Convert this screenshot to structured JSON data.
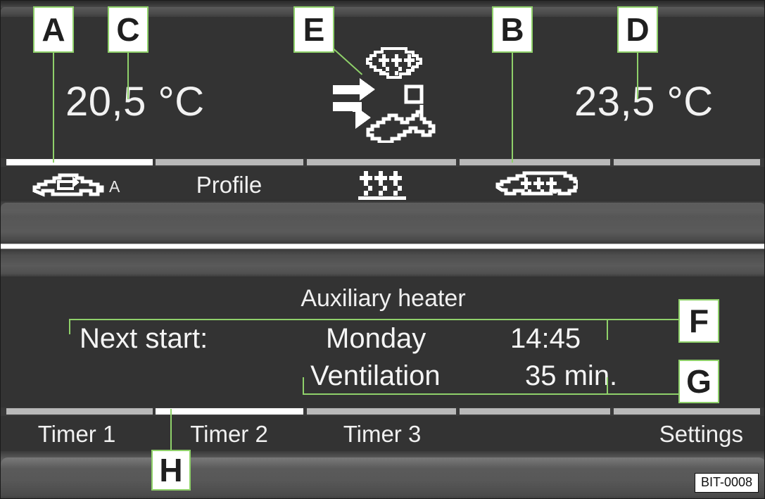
{
  "device": {
    "code_label": "BIT-0008"
  },
  "climate": {
    "temp_left": "20,5 °C",
    "temp_right": "23,5 °C",
    "airflow_icon": "airflow-windshield-and-body-icon"
  },
  "top_tabs": [
    {
      "label": "",
      "icon": "air-recirculation-car-icon",
      "sub": "A",
      "active": true
    },
    {
      "label": "Profile",
      "icon": "",
      "sub": "",
      "active": false
    },
    {
      "label": "",
      "icon": "seat-heating-icon",
      "sub": "",
      "active": false
    },
    {
      "label": "",
      "icon": "rear-window-defrost-icon",
      "sub": "",
      "active": false
    },
    {
      "label": "",
      "icon": "",
      "sub": "",
      "active": false
    }
  ],
  "auxiliary_heater": {
    "title": "Auxiliary heater",
    "next_start_label": "Next start:",
    "next_start_day": "Monday",
    "next_start_time": "14:45",
    "mode_label": "Ventilation",
    "mode_duration": "35 min."
  },
  "bottom_tabs": [
    {
      "label": "Timer 1",
      "active": false
    },
    {
      "label": "Timer 2",
      "active": true
    },
    {
      "label": "Timer 3",
      "active": false
    },
    {
      "label": "",
      "active": false
    },
    {
      "label": "Settings",
      "active": false
    }
  ],
  "callouts": [
    {
      "id": "A",
      "label": "A"
    },
    {
      "id": "C",
      "label": "C"
    },
    {
      "id": "E",
      "label": "E"
    },
    {
      "id": "B",
      "label": "B"
    },
    {
      "id": "D",
      "label": "D"
    },
    {
      "id": "F",
      "label": "F"
    },
    {
      "id": "G",
      "label": "G"
    },
    {
      "id": "H",
      "label": "H"
    }
  ],
  "colors": {
    "callout_border": "#8fd16a",
    "screen_bg": "#333333",
    "active_segment": "#ffffff",
    "inactive_segment": "#b9b9b9",
    "text": "#f0f0f0"
  }
}
